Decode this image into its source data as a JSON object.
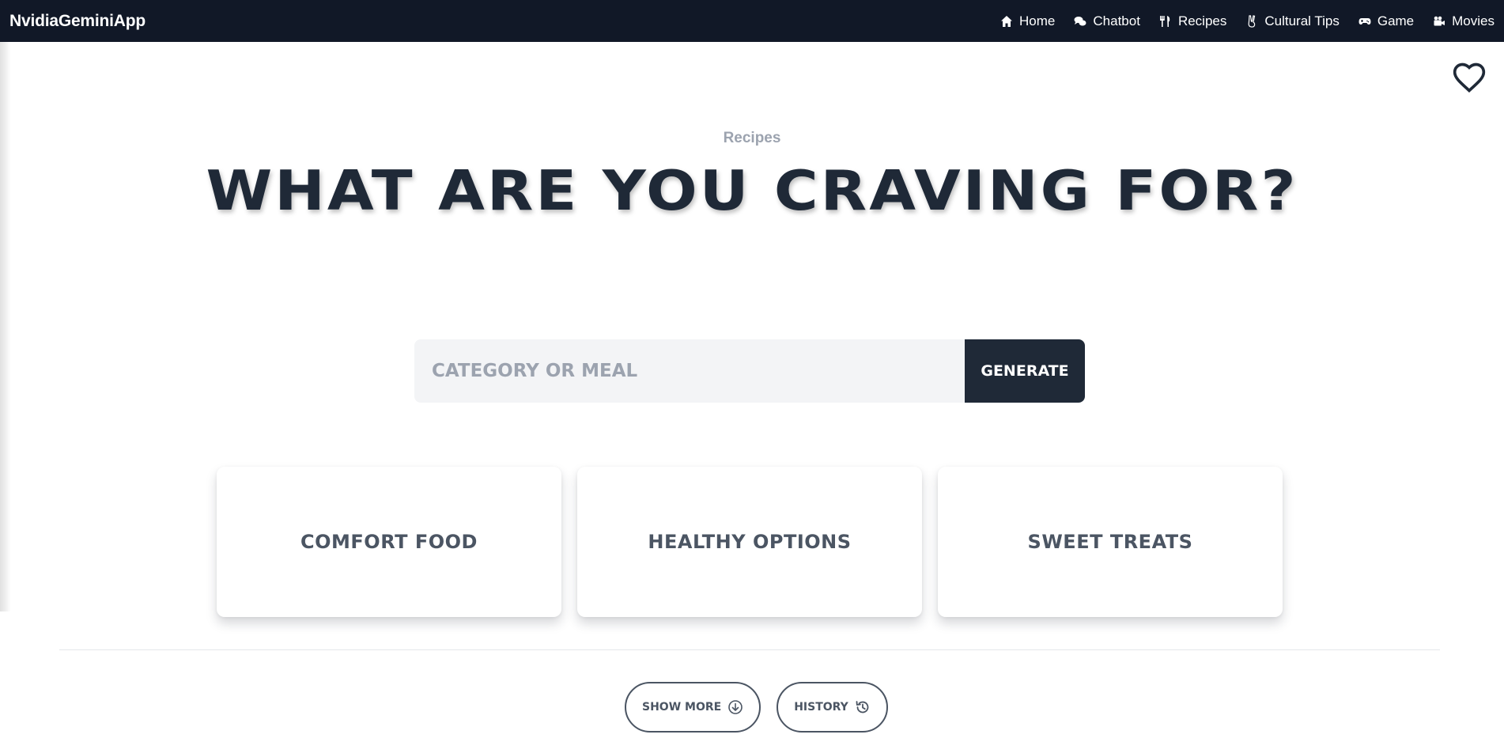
{
  "navbar": {
    "brand": "NvidiaGeminiApp",
    "links": [
      {
        "label": "Home",
        "icon": "home-icon"
      },
      {
        "label": "Chatbot",
        "icon": "chat-icon"
      },
      {
        "label": "Recipes",
        "icon": "utensils-icon"
      },
      {
        "label": "Cultural Tips",
        "icon": "peace-hand-icon"
      },
      {
        "label": "Game",
        "icon": "gamepad-icon"
      },
      {
        "label": "Movies",
        "icon": "video-camera-icon"
      }
    ]
  },
  "hero": {
    "subtitle": "Recipes",
    "title": "What are you craving for?"
  },
  "search": {
    "placeholder": "CATEGORY OR MEAL",
    "value": "",
    "button_label": "Generate"
  },
  "cards": [
    {
      "label": "Comfort Food"
    },
    {
      "label": "Healthy Options"
    },
    {
      "label": "Sweet Treats"
    }
  ],
  "actions": {
    "show_more_label": "Show more",
    "history_label": "History"
  },
  "colors": {
    "navbar_bg": "#111827",
    "primary_dark": "#1f2937",
    "muted_text": "#9ca3af",
    "card_text": "#4b5563",
    "input_bg": "#f3f4f6"
  }
}
